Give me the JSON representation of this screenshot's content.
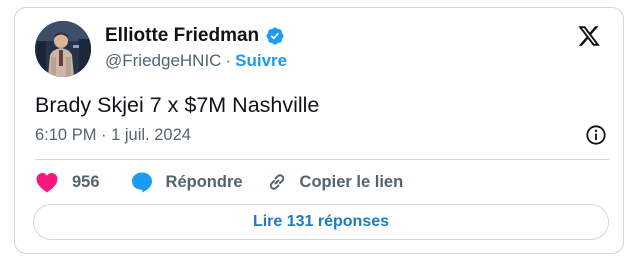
{
  "author": {
    "display_name": "Elliotte Friedman",
    "handle": "@FriedgeHNIC",
    "separator": "·",
    "follow_label": "Suivre",
    "verified_icon": "verified-badge-icon",
    "avatar_icon": "profile-photo"
  },
  "tweet": {
    "text": "Brady Skjei 7 x $7M Nashville",
    "timestamp": "6:10 PM · 1 juil. 2024"
  },
  "actions": {
    "like_count": "956",
    "reply_label": "Répondre",
    "copy_link_label": "Copier le lien"
  },
  "footer": {
    "read_replies_label": "Lire 131 réponses"
  },
  "icons": {
    "platform_logo": "x-logo-icon",
    "info": "info-icon",
    "like": "heart-icon",
    "reply": "speech-bubble-icon",
    "copy_link": "link-icon"
  },
  "colors": {
    "accent": "#1d9bf0",
    "like": "#f91880",
    "text": "#0f1419",
    "secondary": "#536471",
    "border": "#cfd9de"
  }
}
